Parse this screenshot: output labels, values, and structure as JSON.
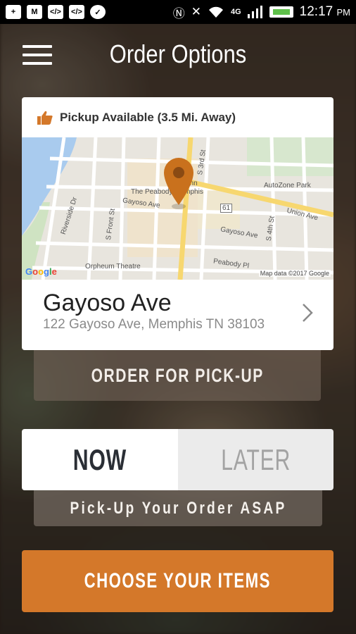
{
  "status_bar": {
    "time": "12:17",
    "ampm": "PM",
    "network": "4G",
    "icons": [
      "plus-icon",
      "gmail-icon",
      "code-icon",
      "code-icon",
      "chat-icon",
      "nfc-icon",
      "vibrate-icon",
      "wifi-icon",
      "signal-icon",
      "battery-icon"
    ]
  },
  "header": {
    "title": "Order Options"
  },
  "location_card": {
    "availability": "Pickup Available (3.5 Mi. Away)",
    "name": "Gayoso Ave",
    "address": "122 Gayoso Ave, Memphis TN 38103",
    "map": {
      "labels": {
        "peabody": "The Peabody Memphis",
        "autozone": "AutoZone Park",
        "union": "Union Ave",
        "gayoso_left": "Gayoso Ave",
        "gayoso_right": "Gayoso Ave",
        "riverside": "Riverside Dr",
        "front": "S Front St",
        "third": "S 3rd St",
        "fourth": "S 4th St",
        "orpheum": "Orpheum Theatre",
        "peabody_pl": "Peabody Pl",
        "tenn": "Tenn",
        "route": "61"
      },
      "google": "Google",
      "credit": "Map data ©2017 Google"
    },
    "pin_color": "#c9711d"
  },
  "pickup_button": {
    "label": "ORDER FOR PICK-UP"
  },
  "time_toggle": {
    "now": "NOW",
    "later": "LATER",
    "selected": "NOW"
  },
  "asap_banner": {
    "text": "Pick-Up Your Order ASAP"
  },
  "choose_button": {
    "label": "CHOOSE YOUR ITEMS"
  },
  "colors": {
    "accent": "#d4782a",
    "active_text": "#2a2e35",
    "inactive_text": "#a3a3a3"
  }
}
